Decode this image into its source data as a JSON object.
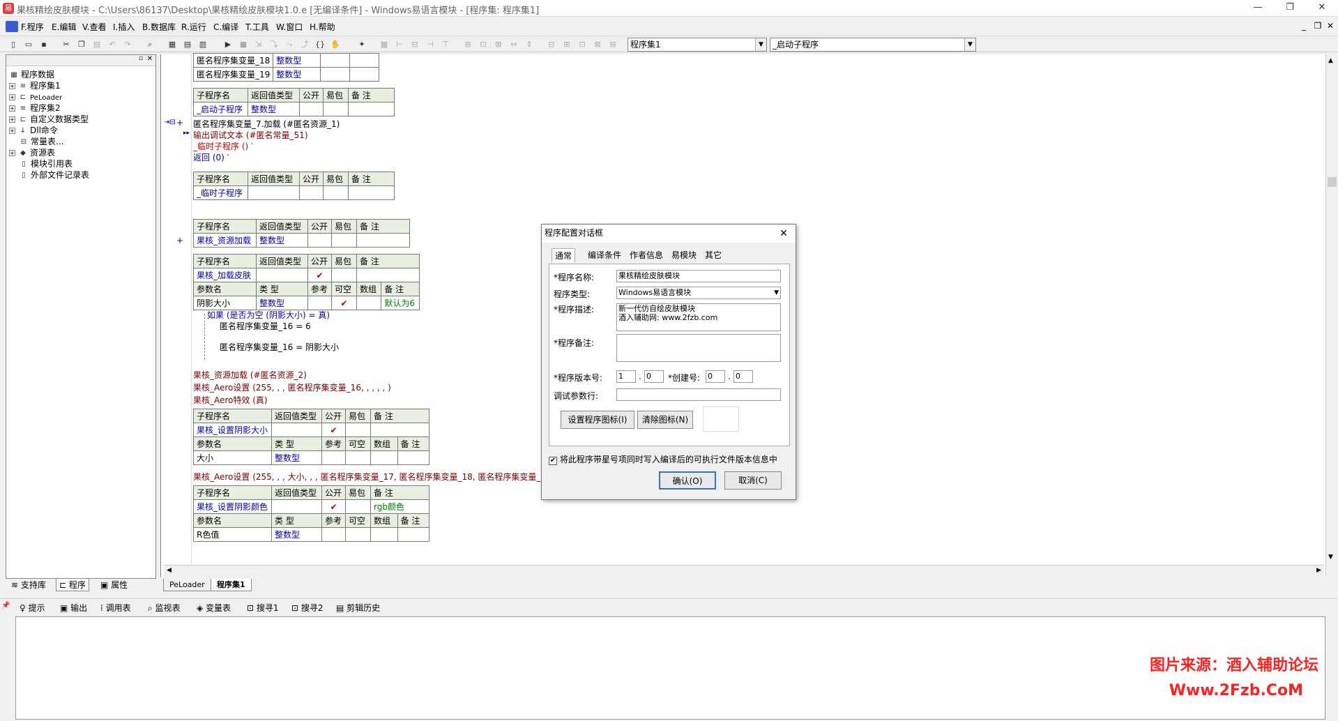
{
  "window": {
    "title": "果核精绘皮肤模块 - C:\\Users\\86137\\Desktop\\果核精绘皮肤模块1.0.e [无编译条件] - Windows易语言模块 - [程序集: 程序集1]",
    "minimize": "—",
    "restore": "❐",
    "close": "✕"
  },
  "menu": [
    "F.程序",
    "E.编辑",
    "V.查看",
    "I.插入",
    "B.数据库",
    "R.运行",
    "C.编译",
    "T.工具",
    "W.窗口",
    "H.帮助"
  ],
  "mdi": {
    "min": "_",
    "restore": "❐",
    "close": "✕"
  },
  "toolbar": {
    "combo_assembly": "程序集1",
    "combo_sub": "_启动子程序"
  },
  "tree": {
    "root": "程序数据",
    "items": [
      "程序集1",
      "PeLoader",
      "程序集2",
      "自定义数据类型",
      "Dll命令",
      "常量表...",
      "资源表",
      "模块引用表",
      "外部文件记录表"
    ]
  },
  "left_tabs": [
    "支持库",
    "程序",
    "属性"
  ],
  "doc_tabs": [
    "PeLoader",
    "程序集1"
  ],
  "bottom_tabs": [
    "提示",
    "输出",
    "调用表",
    "监视表",
    "变量表",
    "搜寻1",
    "搜寻2",
    "剪辑历史"
  ],
  "code": {
    "var18": "匿名程序集变量_18",
    "var19": "匿名程序集变量_19",
    "type_int": "整数型",
    "h_sub": "子程序名",
    "h_ret": "返回值类型",
    "h_pub": "公开",
    "h_pack": "易包",
    "h_note": "备 注",
    "h_param": "参数名",
    "h_type": "类 型",
    "h_ref": "参考",
    "h_opt": "可空",
    "h_arr": "数组",
    "sub_start": "_启动子程序",
    "line1": "匿名程序集变量_7.加载 (#匿名资源_1)",
    "line2": "输出调试文本 (#匿名常量_51)",
    "line3": "_临时子程序 () ′",
    "line4": "返回 (0) ′",
    "sub_temp": "_临时子程序",
    "sub_resload": "果核_资源加载",
    "sub_loadskin": "果核_加载皮肤",
    "param_shadow": "阴影大小",
    "default6": "默认为6",
    "if_line": "如果 (是否为空 (阴影大小) = 真)",
    "assign1": "匿名程序集变量_16 = 6",
    "assign2": "匿名程序集变量_16 = 阴影大小",
    "call1": "果核_资源加载 (#匿名资源_2)",
    "call2": "果核_Aero设置 (255, , , 匿名程序集变量_16, , , , , )",
    "call3": "果核_Aero特效 (真)",
    "sub_setshadow": "果核_设置阴影大小",
    "param_size": "大小",
    "call4": "果核_Aero设置 (255, , , 大小, , , 匿名程序集变量_17, 匿名程序集变量_18, 匿名程序集变量_19)",
    "sub_setcolor": "果核_设置阴影颜色",
    "rgb_note": "rgb颜色",
    "param_r": "R色值"
  },
  "dialog": {
    "title": "程序配置对话框",
    "close": "✕",
    "tabs": [
      "通常",
      "编译条件",
      "作者信息",
      "易模块",
      "其它"
    ],
    "lbl_name": "*程序名称:",
    "val_name": "果核精绘皮肤模块",
    "lbl_type": "程序类型:",
    "val_type": "Windows易语言模块",
    "lbl_desc": "*程序描述:",
    "val_desc1": "新一代仿自绘皮肤模块",
    "val_desc2": "酒入辅助网: www.2fzb.com",
    "lbl_remark": "*程序备注:",
    "lbl_ver": "*程序版本号:",
    "ver_major": "1",
    "ver_minor": "0",
    "lbl_build": "*创建号:",
    "build_major": "0",
    "build_minor": "0",
    "lbl_debug": "调试参数行:",
    "btn_seticon": "设置程序图标(I)",
    "btn_clearicon": "清除图标(N)",
    "chk_label": "将此程序带星号项同时写入编译后的可执行文件版本信息中",
    "btn_ok": "确认(O)",
    "btn_cancel": "取消(C)"
  },
  "watermark": {
    "line1": "图片来源：酒入辅助论坛",
    "line2": "Www.2Fzb.CoM"
  }
}
